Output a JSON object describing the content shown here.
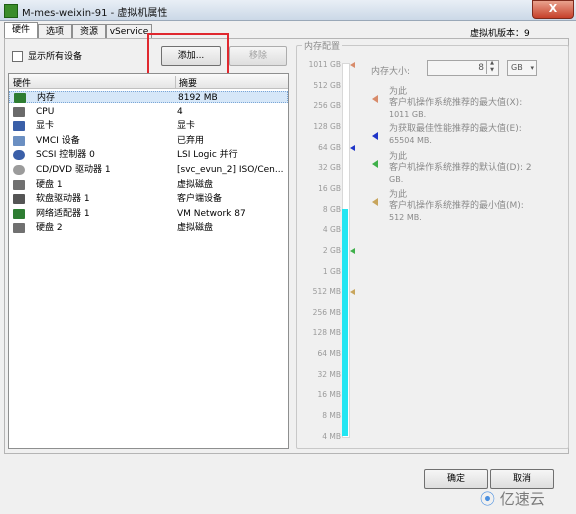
{
  "window": {
    "title": "M-mes-weixin-91 - 虚拟机属性",
    "close_label": "X"
  },
  "tabs": [
    "硬件",
    "选项",
    "资源",
    "vService"
  ],
  "vm_version_label": "虚拟机版本：9",
  "show_all_devices_label": "显示所有设备",
  "buttons": {
    "add": "添加...",
    "remove": "移除",
    "ok": "确定",
    "cancel": "取消"
  },
  "hardware_table": {
    "headers": [
      "硬件",
      "摘要"
    ],
    "rows": [
      {
        "name": "内存",
        "summary": "8192 MB",
        "icon": "memory-icon",
        "selected": true
      },
      {
        "name": "CPU",
        "summary": "4",
        "icon": "cpu-icon"
      },
      {
        "name": "显卡",
        "summary": "显卡",
        "icon": "video-card-icon"
      },
      {
        "name": "VMCI 设备",
        "summary": "已弃用",
        "icon": "vmci-device-icon"
      },
      {
        "name": "SCSI 控制器 0",
        "summary": "LSI Logic 并行",
        "icon": "scsi-controller-icon"
      },
      {
        "name": "CD/DVD 驱动器 1",
        "summary": "[svc_evun_2] ISO/Cen...",
        "icon": "cd-dvd-drive-icon"
      },
      {
        "name": "硬盘 1",
        "summary": "虚拟磁盘",
        "icon": "hard-disk-icon"
      },
      {
        "name": "软盘驱动器 1",
        "summary": "客户端设备",
        "icon": "floppy-drive-icon"
      },
      {
        "name": "网络适配器 1",
        "summary": "VM Network 87",
        "icon": "network-adapter-icon"
      },
      {
        "name": "硬盘 2",
        "summary": "虚拟磁盘",
        "icon": "hard-disk-icon"
      }
    ]
  },
  "memory_config": {
    "legend": "内存配置",
    "size_label": "内存大小:",
    "size_value": "8",
    "unit": "GB",
    "scale_ticks": [
      "1011 GB",
      "512 GB",
      "256 GB",
      "128 GB",
      "64 GB",
      "32 GB",
      "16 GB",
      "8 GB",
      "4 GB",
      "2 GB",
      "1 GB",
      "512 MB",
      "256 MB",
      "128 MB",
      "64 MB",
      "32 MB",
      "16 MB",
      "8 MB",
      "4 MB"
    ],
    "current_level_gb": 8,
    "notes": [
      {
        "title": "为此",
        "line": "客户机操作系统推荐的最大值(X):",
        "value": "1011 GB.",
        "color": "#d88b6a"
      },
      {
        "title": "",
        "line": "为获取最佳性能推荐的最大值(E):",
        "value": "65504 MB.",
        "color": "#1f35c8"
      },
      {
        "title": "为此",
        "line": "客户机操作系统推荐的默认值(D): 2",
        "value": "GB.",
        "color": "#3fb04a"
      },
      {
        "title": "为此",
        "line": "客户机操作系统推荐的最小值(M):",
        "value": "512 MB.",
        "color": "#c8a55c"
      }
    ]
  },
  "watermark": "亿速云"
}
